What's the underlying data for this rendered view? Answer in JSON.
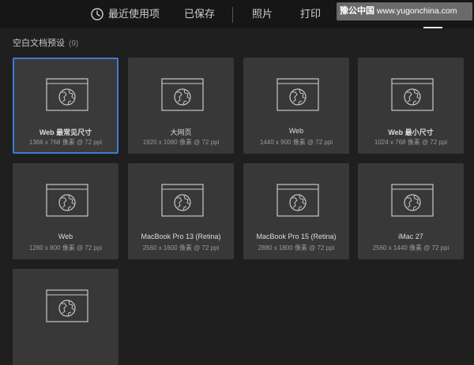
{
  "top_tabs": {
    "recent": "最近使用项",
    "saved": "已保存",
    "photo": "照片",
    "print": "打印"
  },
  "watermark": {
    "name": "豫公中国",
    "url": "www.yugonchina.com"
  },
  "section": {
    "title": "空白文档预设",
    "count": "(9)"
  },
  "presets": [
    {
      "name": "Web 最常见尺寸",
      "dims": "1366 x 768 像素 @ 72 ppi",
      "selected": true
    },
    {
      "name": "大网页",
      "dims": "1920 x 1080 像素 @ 72 ppi"
    },
    {
      "name": "Web",
      "dims": "1440 x 900 像素 @ 72 ppi"
    },
    {
      "name": "Web 最小尺寸",
      "dims": "1024 x 768 像素 @ 72 ppi"
    },
    {
      "name": "Web",
      "dims": "1280 x 800 像素 @ 72 ppi"
    },
    {
      "name": "MacBook Pro 13 (Retina)",
      "dims": "2560 x 1600 像素 @ 72 ppi"
    },
    {
      "name": "MacBook Pro 15 (Retina)",
      "dims": "2880 x 1800 像素 @ 72 ppi"
    },
    {
      "name": "iMac 27",
      "dims": "2560 x 1440 像素 @ 72 ppi"
    },
    {
      "name": "",
      "dims": ""
    }
  ],
  "colors": {
    "background": "#1f1f1f",
    "card": "#383838",
    "selected_border": "#3b7bd6",
    "icon_stroke": "#c8c8c8"
  },
  "icons": {
    "recent_tab": "clock-icon",
    "preset": "web-document-globe-icon"
  }
}
